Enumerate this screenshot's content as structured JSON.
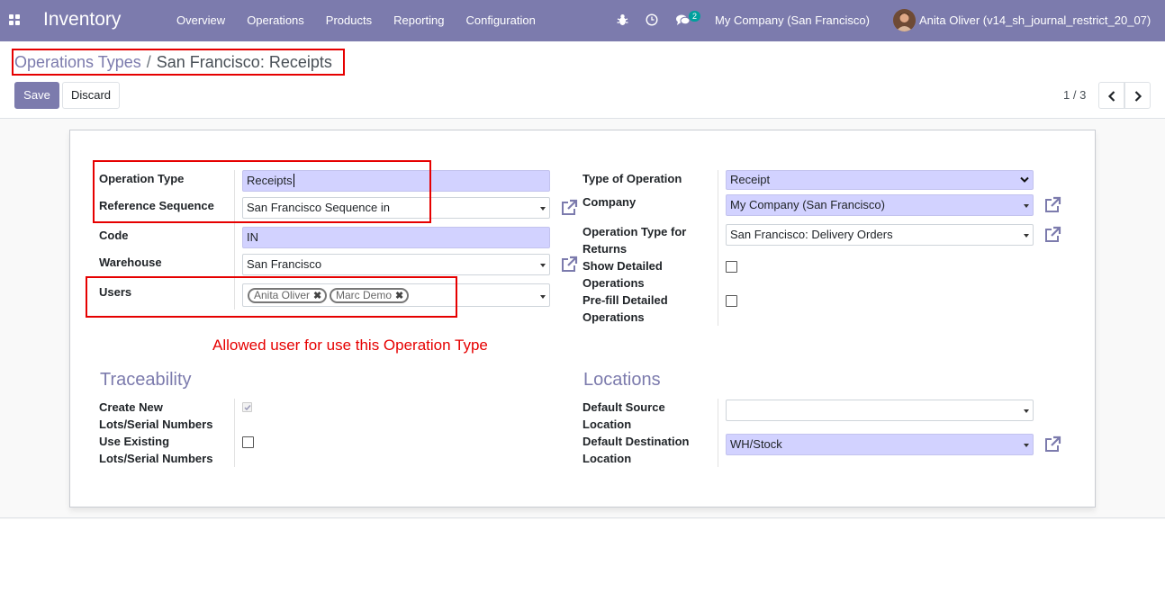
{
  "navbar": {
    "app_name": "Inventory",
    "menu": [
      "Overview",
      "Operations",
      "Products",
      "Reporting",
      "Configuration"
    ],
    "chat_count": "2",
    "company": "My Company (San Francisco)",
    "user": "Anita Oliver (v14_sh_journal_restrict_20_07)"
  },
  "breadcrumb": {
    "parent": "Operations Types",
    "separator": "/",
    "current": "San Francisco: Receipts"
  },
  "toolbar": {
    "save_label": "Save",
    "discard_label": "Discard",
    "pager": "1 / 3"
  },
  "form": {
    "left": {
      "operation_type_label": "Operation Type",
      "operation_type_value": "Receipts",
      "reference_sequence_label": "Reference Sequence",
      "reference_sequence_value": "San Francisco Sequence in",
      "code_label": "Code",
      "code_value": "IN",
      "warehouse_label": "Warehouse",
      "warehouse_value": "San Francisco",
      "users_label": "Users",
      "users": [
        "Anita Oliver",
        "Marc Demo"
      ]
    },
    "right": {
      "type_of_operation_label": "Type of Operation",
      "type_of_operation_value": "Receipt",
      "company_label": "Company",
      "company_value": "My Company (San Francisco)",
      "return_type_label_1": "Operation Type for",
      "return_type_label_2": "Returns",
      "return_type_value": "San Francisco: Delivery Orders",
      "show_detailed_label_1": "Show Detailed",
      "show_detailed_label_2": "Operations",
      "prefill_label_1": "Pre-fill Detailed",
      "prefill_label_2": "Operations"
    },
    "annotation": "Allowed user for use this Operation Type",
    "traceability": {
      "title": "Traceability",
      "create_new_label_1": "Create New",
      "create_new_label_2": "Lots/Serial Numbers",
      "use_existing_label_1": "Use Existing",
      "use_existing_label_2": "Lots/Serial Numbers"
    },
    "locations": {
      "title": "Locations",
      "default_source_label_1": "Default Source",
      "default_source_label_2": "Location",
      "default_source_value": "",
      "default_dest_label_1": "Default Destination",
      "default_dest_label_2": "Location",
      "default_dest_value": "WH/Stock"
    }
  },
  "colors": {
    "brand": "#7c7bad",
    "required_field": "#d2d2ff",
    "annotation": "#e60000"
  }
}
